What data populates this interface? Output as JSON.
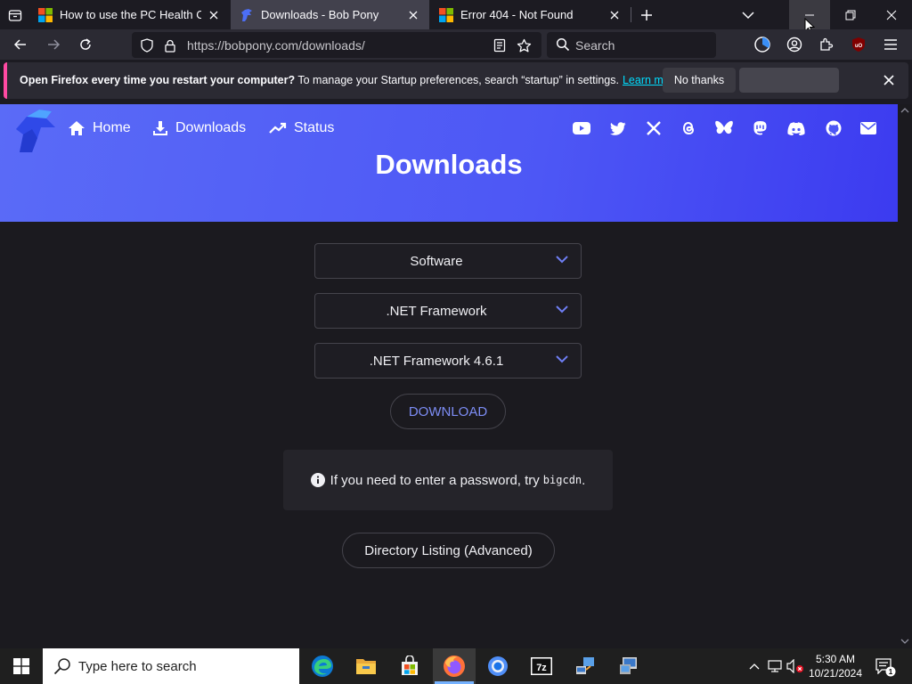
{
  "tabs": [
    {
      "title": "How to use the PC Health Check",
      "favicon": "windows-logo-icon"
    },
    {
      "title": "Downloads - Bob Pony",
      "favicon": "bobpony-logo-icon",
      "active": true
    },
    {
      "title": "Error 404 - Not Found",
      "favicon": "windows-logo-icon"
    }
  ],
  "nav": {
    "url": "https://bobpony.com/downloads/",
    "search_placeholder": "Search"
  },
  "notification": {
    "bold": "Open Firefox every time you restart your computer?",
    "text": "To manage your Startup preferences, search “startup” in settings.",
    "link": "Learn more",
    "no_thanks": "No thanks"
  },
  "site": {
    "nav": {
      "home": "Home",
      "downloads": "Downloads",
      "status": "Status"
    },
    "social_icons": [
      "youtube-icon",
      "twitter-icon",
      "x-icon",
      "threads-icon",
      "bluesky-icon",
      "mastodon-icon",
      "discord-icon",
      "github-icon",
      "email-icon"
    ],
    "title": "Downloads",
    "dropdowns": [
      "Software",
      ".NET Framework",
      ".NET Framework 4.6.1"
    ],
    "download_button": "DOWNLOAD",
    "info_text": "If you need to enter a password, try",
    "info_code": "bigcdn",
    "info_end": ".",
    "directory_button": "Directory Listing (Advanced)"
  },
  "taskbar": {
    "search_placeholder": "Type here to search",
    "apps": [
      "edge-icon",
      "file-explorer-icon",
      "store-icon",
      "firefox-icon",
      "chrome-icon",
      "7zip-icon",
      "network-tool-icon",
      "app-icon"
    ],
    "time": "5:30 AM",
    "date": "10/21/2024"
  },
  "colors": {
    "accent": "#4d57f5",
    "tab_active": "#42414d",
    "notification_accent": "#ff4aa2",
    "link": "#00ddff"
  }
}
